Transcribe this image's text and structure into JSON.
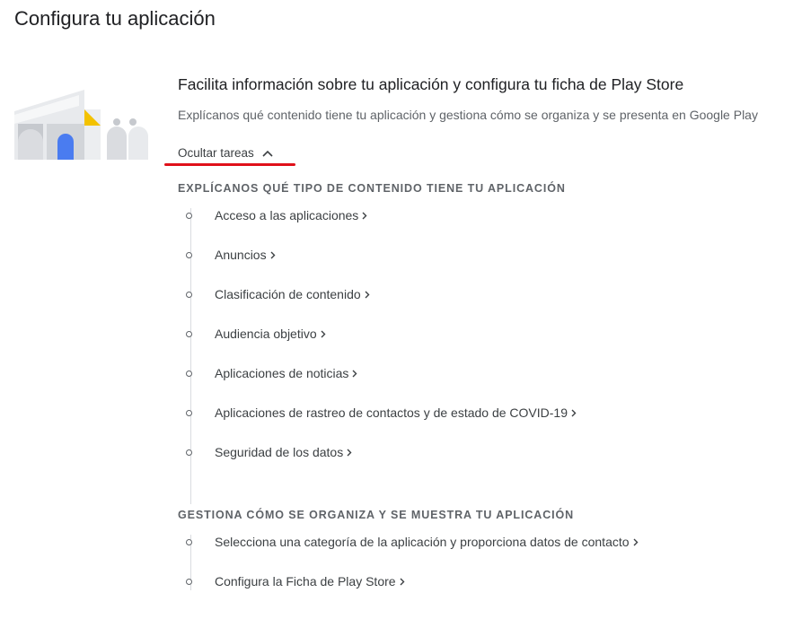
{
  "page": {
    "title": "Configura tu aplicación"
  },
  "setup": {
    "title": "Facilita información sobre tu aplicación y configura tu ficha de Play Store",
    "description": "Explícanos qué contenido tiene tu aplicación y gestiona cómo se organiza y se presenta en Google Play",
    "toggle_label": "Ocultar tareas",
    "toggle_icon": "chevron-up-icon",
    "chevron_icon": "chevron-right-icon",
    "colors": {
      "underline": "#e0111a",
      "illustration_blue": "#4a7cf0",
      "illustration_yellow": "#f3c200"
    }
  },
  "groups": [
    {
      "heading": "EXPLÍCANOS QUÉ TIPO DE CONTENIDO TIENE TU APLICACIÓN",
      "tasks": [
        {
          "label": "Acceso a las aplicaciones"
        },
        {
          "label": "Anuncios"
        },
        {
          "label": "Clasificación de contenido"
        },
        {
          "label": "Audiencia objetivo"
        },
        {
          "label": "Aplicaciones de noticias"
        },
        {
          "label": "Aplicaciones de rastreo de contactos y de estado de COVID-19"
        },
        {
          "label": "Seguridad de los datos"
        }
      ]
    },
    {
      "heading": "GESTIONA CÓMO SE ORGANIZA Y SE MUESTRA TU APLICACIÓN",
      "tasks": [
        {
          "label": "Selecciona una categoría de la aplicación y proporciona datos de contacto"
        },
        {
          "label": "Configura la Ficha de Play Store"
        }
      ]
    }
  ]
}
